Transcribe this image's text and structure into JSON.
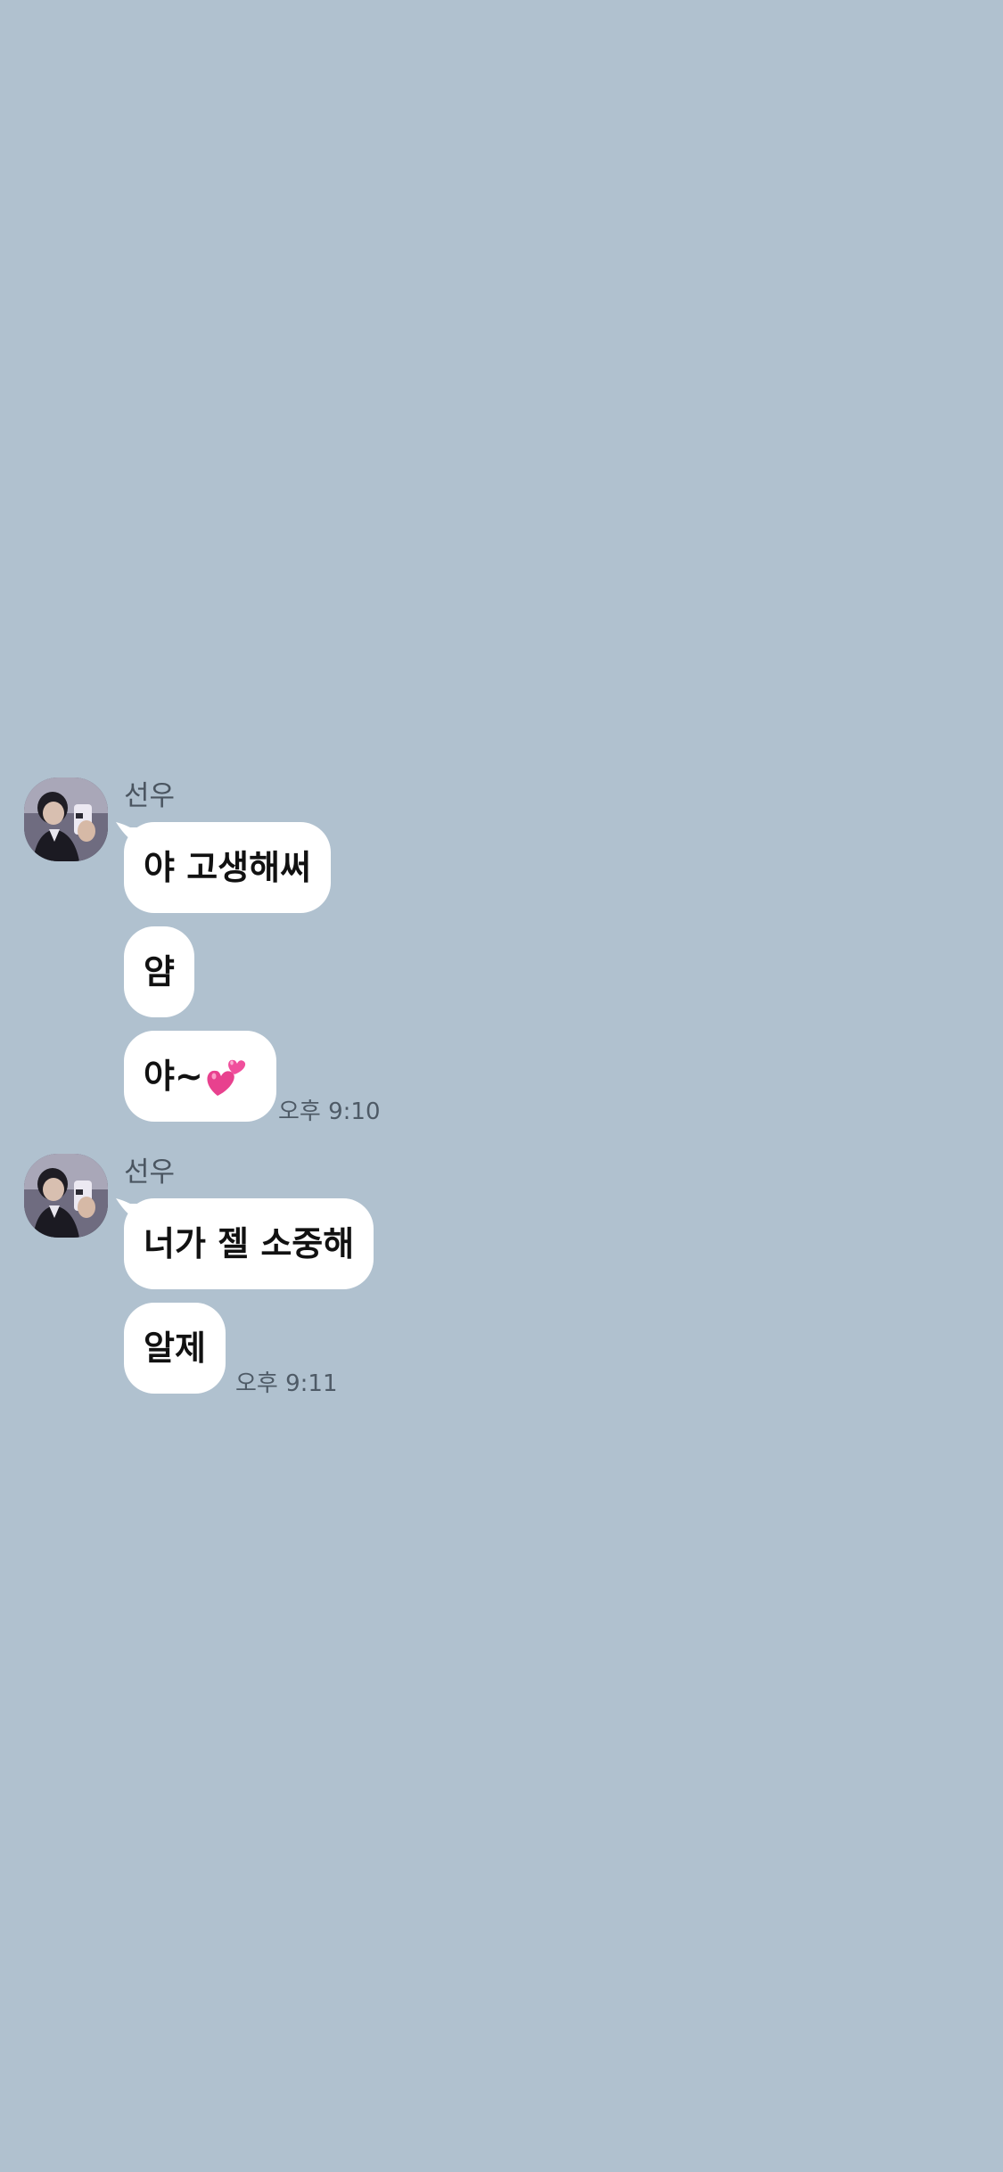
{
  "chat": {
    "groups": [
      {
        "sender": "선우",
        "messages": [
          "야 고생해써",
          "얌",
          "야~"
        ],
        "time": "오후 9:10"
      },
      {
        "sender": "선우",
        "messages": [
          "너가 젤 소중해",
          "알제"
        ],
        "time": "오후 9:11"
      }
    ],
    "icons": {
      "emoji": "two-hearts-icon",
      "profile": "profile-photo"
    },
    "colors": {
      "background": "#b0c1cf",
      "bubble": "#ffffff",
      "heart": "#e8418e"
    }
  }
}
